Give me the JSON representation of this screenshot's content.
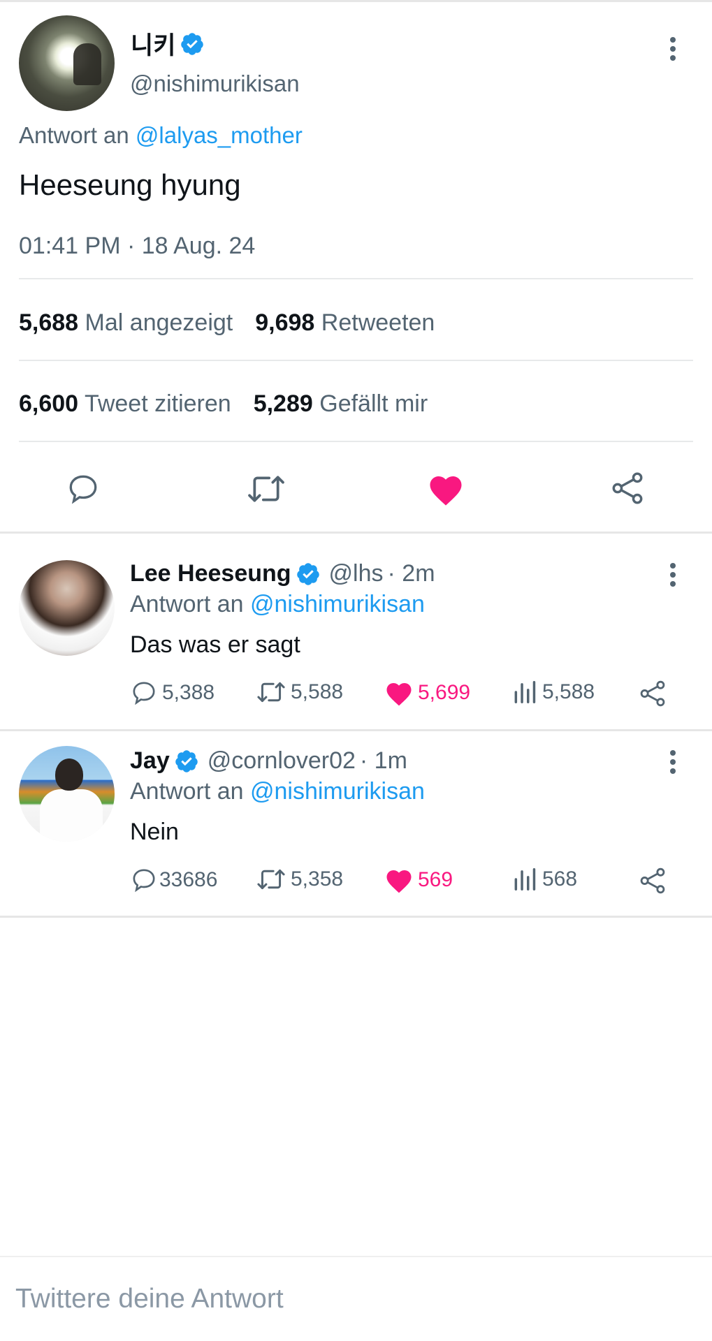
{
  "main_tweet": {
    "author_name": "니키",
    "author_handle": "@nishimurikisan",
    "reply_prefix": "Antwort an",
    "reply_handle": "@lalyas_mother",
    "text": "Heeseung hyung",
    "timestamp": "01:41 PM · 18 Aug. 24",
    "stats": {
      "views_count": "5,688",
      "views_label": "Mal angezeigt",
      "retweets_count": "9,698",
      "retweets_label": "Retweeten",
      "quotes_count": "6,600",
      "quotes_label": "Tweet zitieren",
      "likes_count": "5,289",
      "likes_label": "Gefällt mir"
    },
    "liked": true
  },
  "replies": [
    {
      "author_name": "Lee Heeseung",
      "author_handle": "@lhs",
      "age": "· 2m",
      "reply_prefix": "Antwort an",
      "reply_handle": "@nishimurikisan",
      "text": "Das was er sagt",
      "reply_count": "5,388",
      "retweet_count": "5,588",
      "like_count": "5,699",
      "view_count": "5,588"
    },
    {
      "author_name": "Jay",
      "author_handle": "@cornlover02",
      "age": "· 1m",
      "reply_prefix": "Antwort an",
      "reply_handle": "@nishimurikisan",
      "text": "Nein",
      "reply_count": "33686",
      "retweet_count": "5,358",
      "like_count": "569",
      "view_count": "568"
    }
  ],
  "composer": {
    "placeholder": "Twittere deine Antwort"
  },
  "colors": {
    "accent": "#1d9bf0",
    "like": "#f91880",
    "muted": "#536471",
    "text": "#0f1419"
  }
}
